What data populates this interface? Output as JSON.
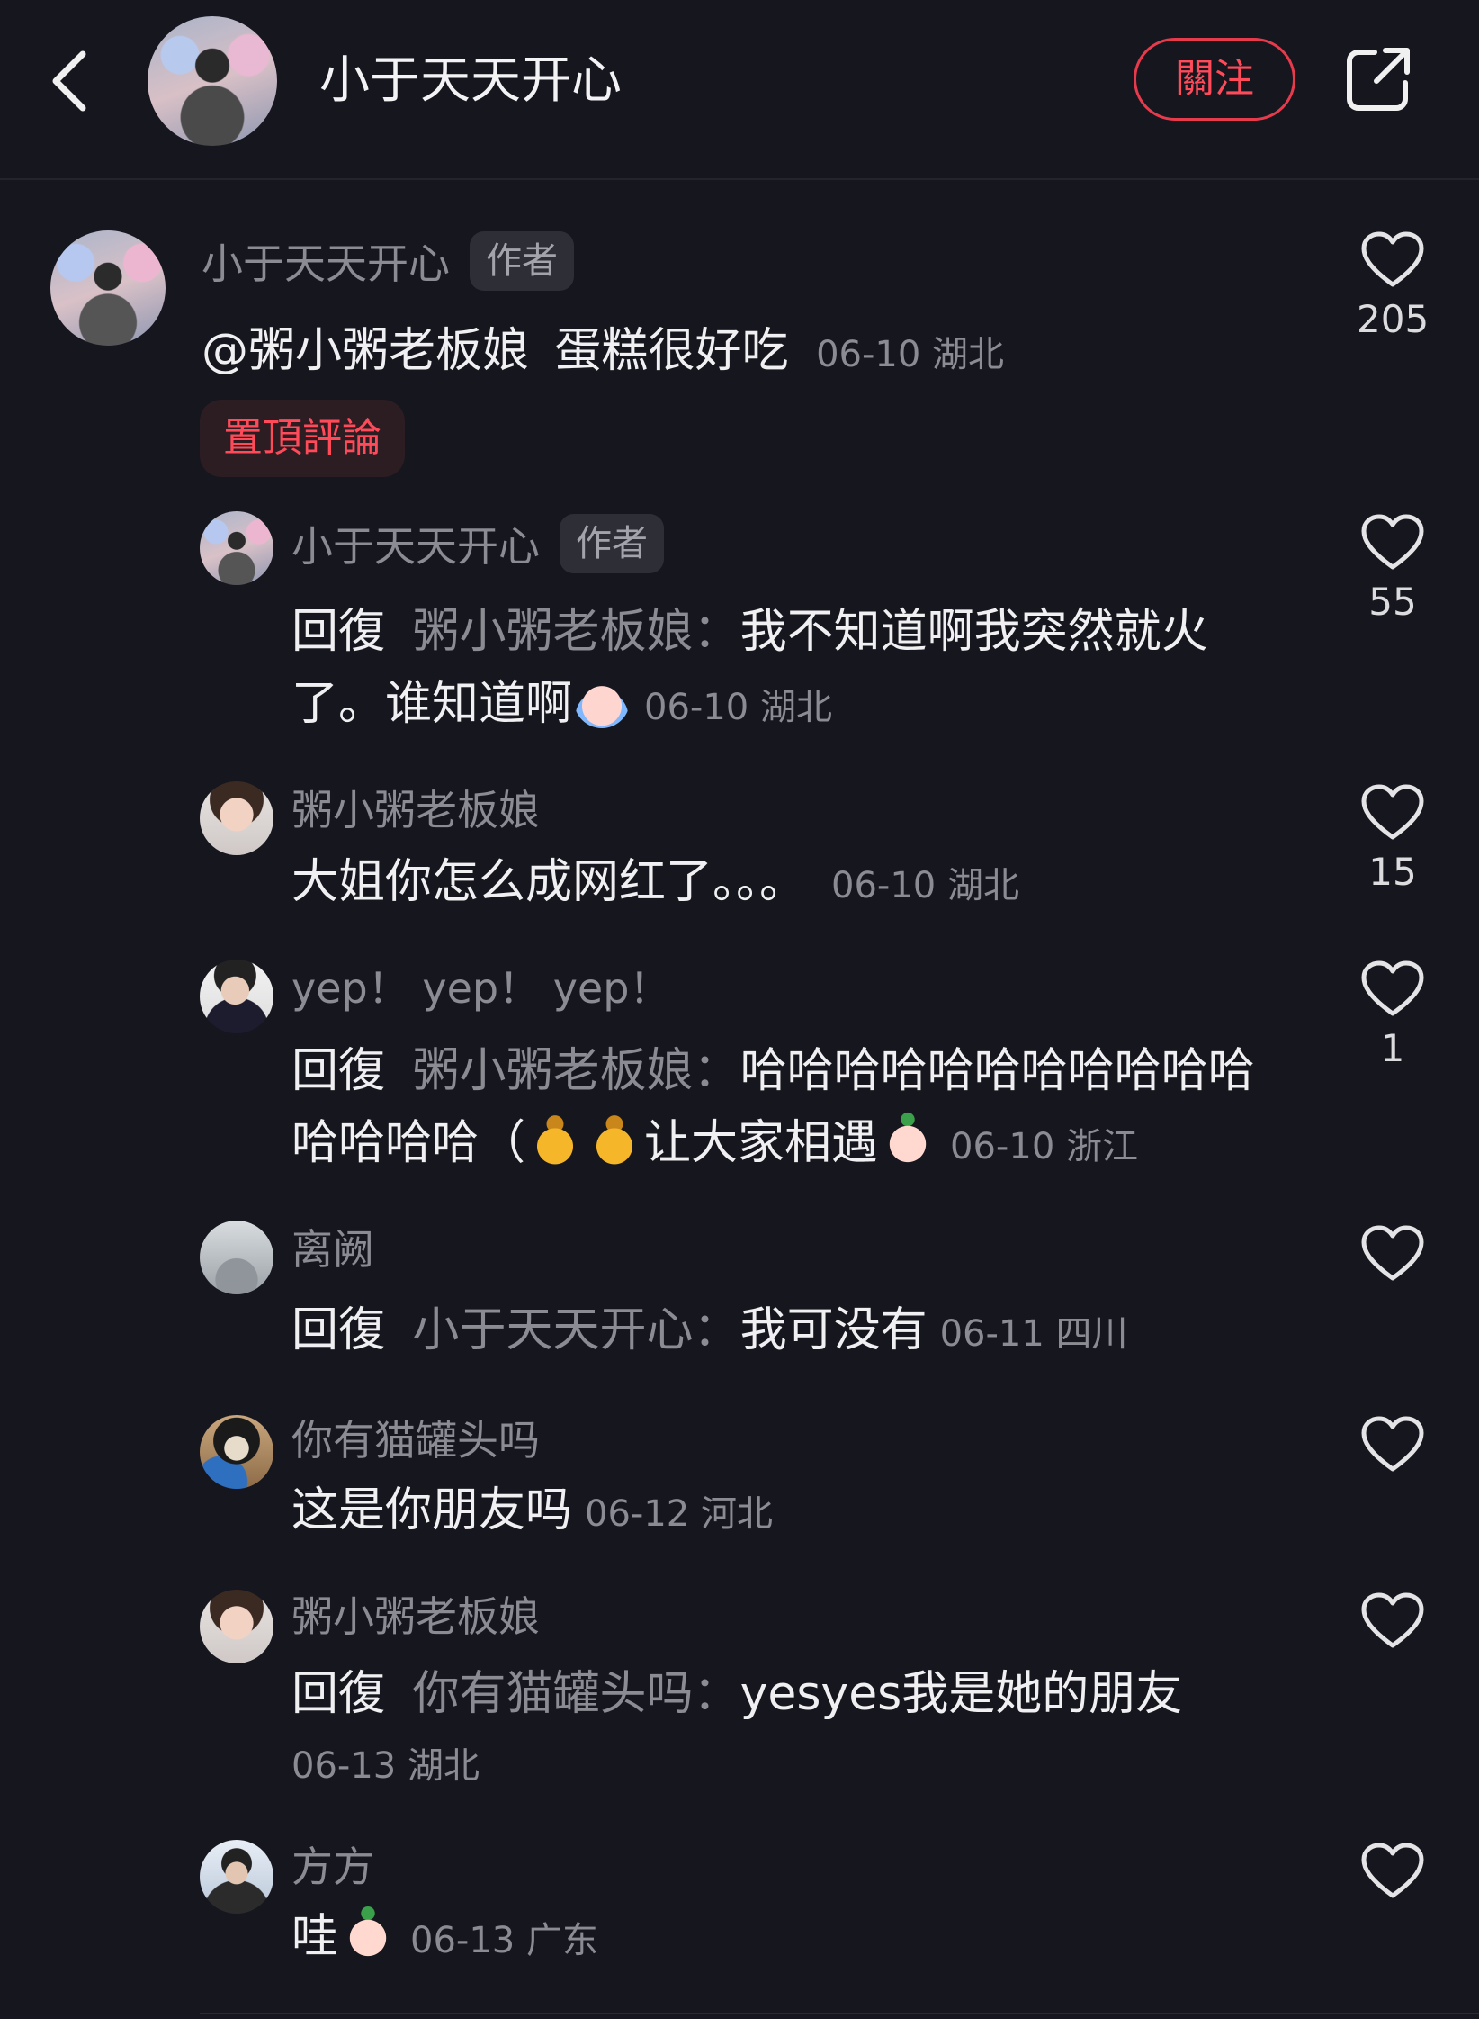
{
  "header": {
    "title": "小于天天开心",
    "follow_label": "關注",
    "back_icon": "chevron-left-icon",
    "share_icon": "share-icon"
  },
  "comments": [
    {
      "user": "小于天天开心",
      "author_tag": "作者",
      "mention": "@粥小粥老板娘",
      "text": "蛋糕很好吃",
      "meta": "06-10 湖北",
      "pinned_label": "置頂評論",
      "likes": "205"
    },
    {
      "user": "小于天天开心",
      "author_tag": "作者",
      "reply_label": "回復",
      "reply_to": "粥小粥老板娘：",
      "text": "我不知道啊我突然就火了。谁知道啊",
      "meta": "06-10 湖北",
      "likes": "55"
    },
    {
      "user": "粥小粥老板娘",
      "text": "大姐你怎么成网红了。。。",
      "meta": "06-10 湖北",
      "likes": "15"
    },
    {
      "user": "yep！ yep！ yep！",
      "reply_label": "回復",
      "reply_to": "粥小粥老板娘：",
      "text": "哈哈哈哈哈哈哈哈哈哈哈哈哈哈哈（",
      "text2": "让大家相遇",
      "meta": "06-10 浙江",
      "likes": "1"
    },
    {
      "user": "离阙",
      "reply_label": "回復",
      "reply_to": "小于天天开心：",
      "text": "我可没有",
      "meta": "06-11 四川",
      "likes": ""
    },
    {
      "user": "你有猫罐头吗",
      "text": "这是你朋友吗",
      "meta": "06-12 河北",
      "likes": ""
    },
    {
      "user": "粥小粥老板娘",
      "reply_label": "回復",
      "reply_to": "你有猫罐头吗：",
      "text": "yesyes我是她的朋友",
      "meta": "06-13 湖北",
      "likes": ""
    },
    {
      "user": "方方",
      "text": "哇",
      "meta": "06-13 广东",
      "likes": ""
    }
  ],
  "colors": {
    "background": "#16161e",
    "accent": "#ff4a5a",
    "secondary_text": "#8b8b93"
  }
}
